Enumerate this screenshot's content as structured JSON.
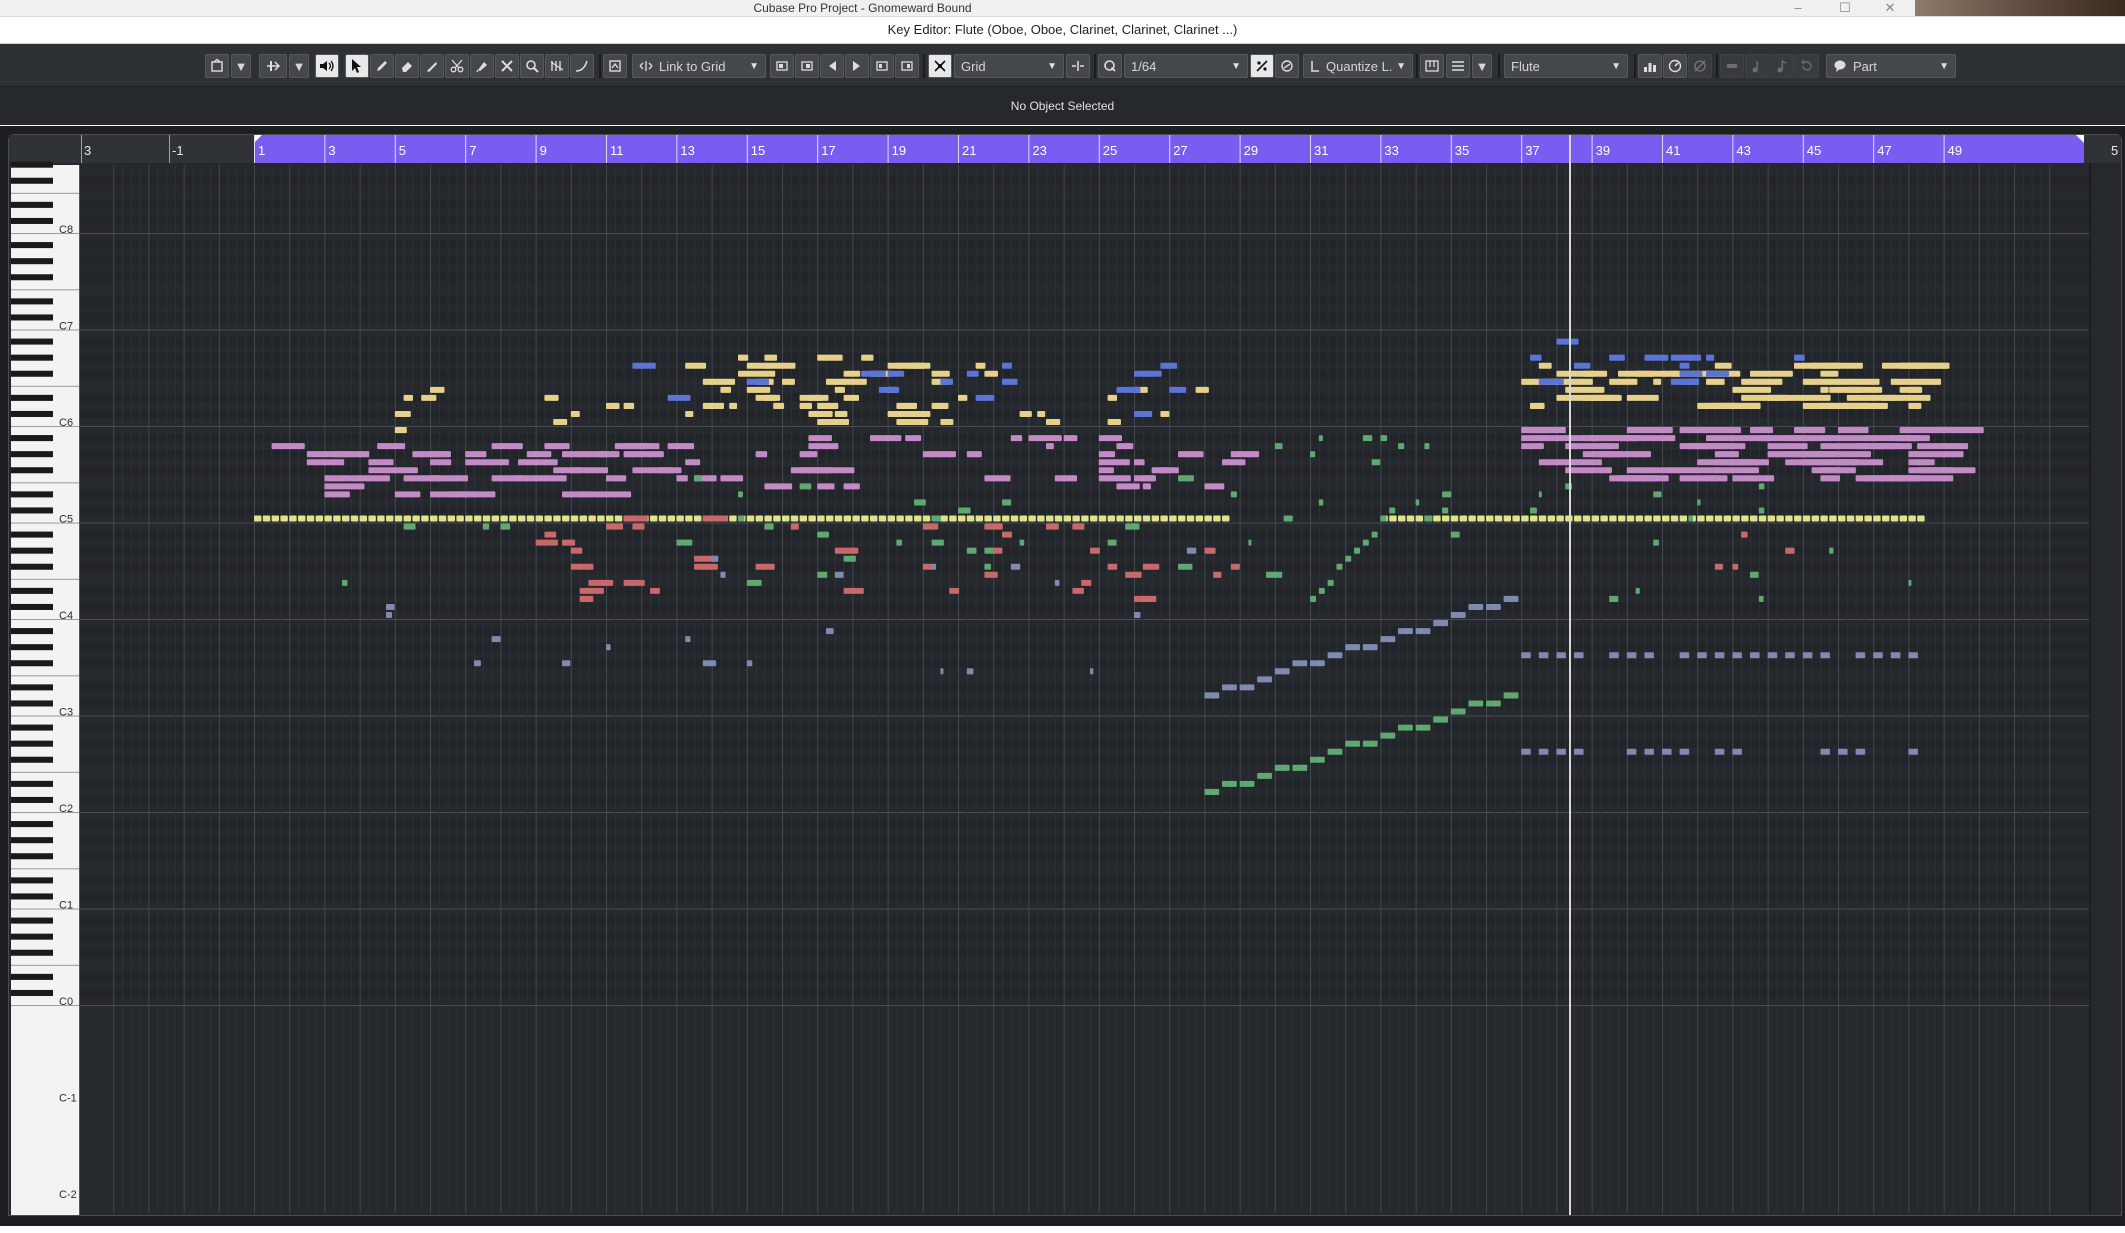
{
  "window": {
    "title": "Cubase Pro Project - Gnomeward Bound",
    "minimize_glyph": "–",
    "maximize_glyph": "☐",
    "close_glyph": "✕"
  },
  "editor_window": {
    "title": "Key Editor: Flute (Oboe, Oboe, Clarinet, Clarinet, Clarinet ...)"
  },
  "toolbar": {
    "snap_type": "Link to Grid",
    "grid_type": "Grid",
    "quantize_value": "1/64",
    "quantize_length": "Quantize L.",
    "track_select": "Flute",
    "part_select": "Part"
  },
  "info_line": {
    "status": "No Object Selected"
  },
  "ruler": {
    "pre_labels": [
      "3",
      "-1"
    ],
    "bars": [
      "1",
      "3",
      "5",
      "7",
      "9",
      "11",
      "13",
      "15",
      "17",
      "19",
      "21",
      "23",
      "25",
      "27",
      "29",
      "31",
      "33",
      "35",
      "37",
      "39",
      "41",
      "43",
      "45",
      "47",
      "49"
    ],
    "trailing_label": "5"
  },
  "keyboard": {
    "octave_labels": [
      "C8",
      "C7",
      "C6",
      "C5",
      "C4",
      "C3",
      "C2",
      "C1",
      "C0",
      "C-1",
      "C-2"
    ]
  },
  "colors": {
    "ruler_purple": "#7a5cf0",
    "note_yellow": "#e6d08a",
    "note_pink": "#c48ac8",
    "note_blue": "#5a74d8",
    "note_green": "#5fa870",
    "note_red": "#c86868",
    "note_slate": "#7f8ab0",
    "note_lime": "#dfe38a",
    "background": "#25282d",
    "cursor_line": "#d8d8d8"
  }
}
